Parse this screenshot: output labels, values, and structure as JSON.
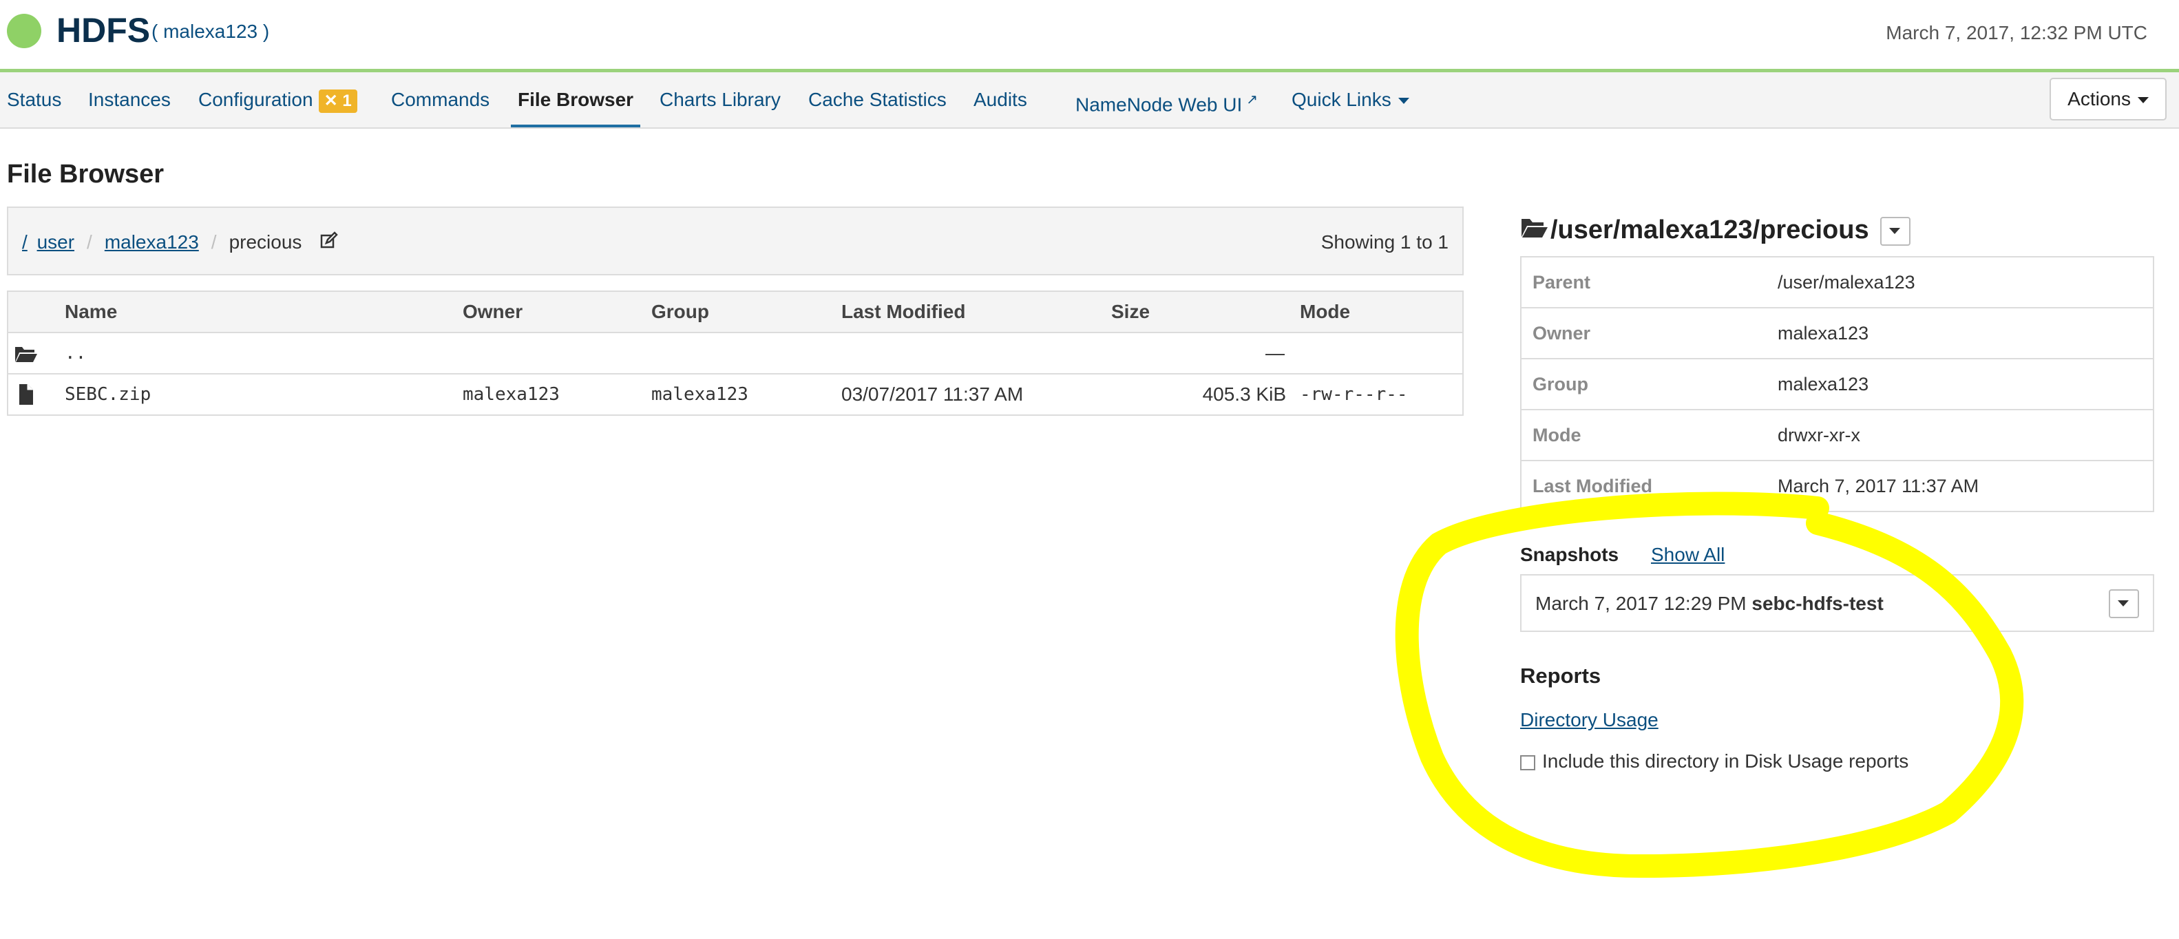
{
  "header": {
    "service_name": "HDFS",
    "cluster_name": "( malexa123 )",
    "timestamp": "March 7, 2017, 12:32 PM UTC",
    "status_color": "#8fd166"
  },
  "nav": {
    "tabs": [
      {
        "label": "Status"
      },
      {
        "label": "Instances"
      },
      {
        "label": "Configuration",
        "badge": "1"
      },
      {
        "label": "Commands"
      },
      {
        "label": "File Browser",
        "active": true
      },
      {
        "label": "Charts Library"
      },
      {
        "label": "Cache Statistics"
      },
      {
        "label": "Audits"
      },
      {
        "label": "NameNode Web UI"
      },
      {
        "label": "Quick Links"
      }
    ],
    "actions_label": "Actions"
  },
  "page_title": "File Browser",
  "breadcrumb": {
    "root": "/",
    "parts": [
      "user",
      "malexa123",
      "precious"
    ],
    "showing": "Showing 1 to 1"
  },
  "file_table": {
    "columns": [
      "Name",
      "Owner",
      "Group",
      "Last Modified",
      "Size",
      "Mode"
    ],
    "parent_row": {
      "name": "..",
      "mode": "—"
    },
    "rows": [
      {
        "name": "SEBC.zip",
        "owner": "malexa123",
        "group": "malexa123",
        "modified": "03/07/2017 11:37 AM",
        "size": "405.3 KiB",
        "mode": "-rw-r--r--"
      }
    ]
  },
  "directory": {
    "path": "/user/malexa123/precious",
    "properties": [
      {
        "key": "Parent",
        "value": "/user/malexa123"
      },
      {
        "key": "Owner",
        "value": "malexa123"
      },
      {
        "key": "Group",
        "value": "malexa123"
      },
      {
        "key": "Mode",
        "value": "drwxr-xr-x"
      },
      {
        "key": "Last Modified",
        "value": "March 7, 2017 11:37 AM"
      }
    ]
  },
  "snapshots": {
    "label": "Snapshots",
    "show_all": "Show All",
    "selected_time": "March 7, 2017 12:29 PM",
    "selected_name": "sebc-hdfs-test"
  },
  "reports": {
    "label": "Reports",
    "directory_usage": "Directory Usage",
    "include_label": "Include this directory in Disk Usage reports"
  },
  "annotation_color": "#ffff00"
}
